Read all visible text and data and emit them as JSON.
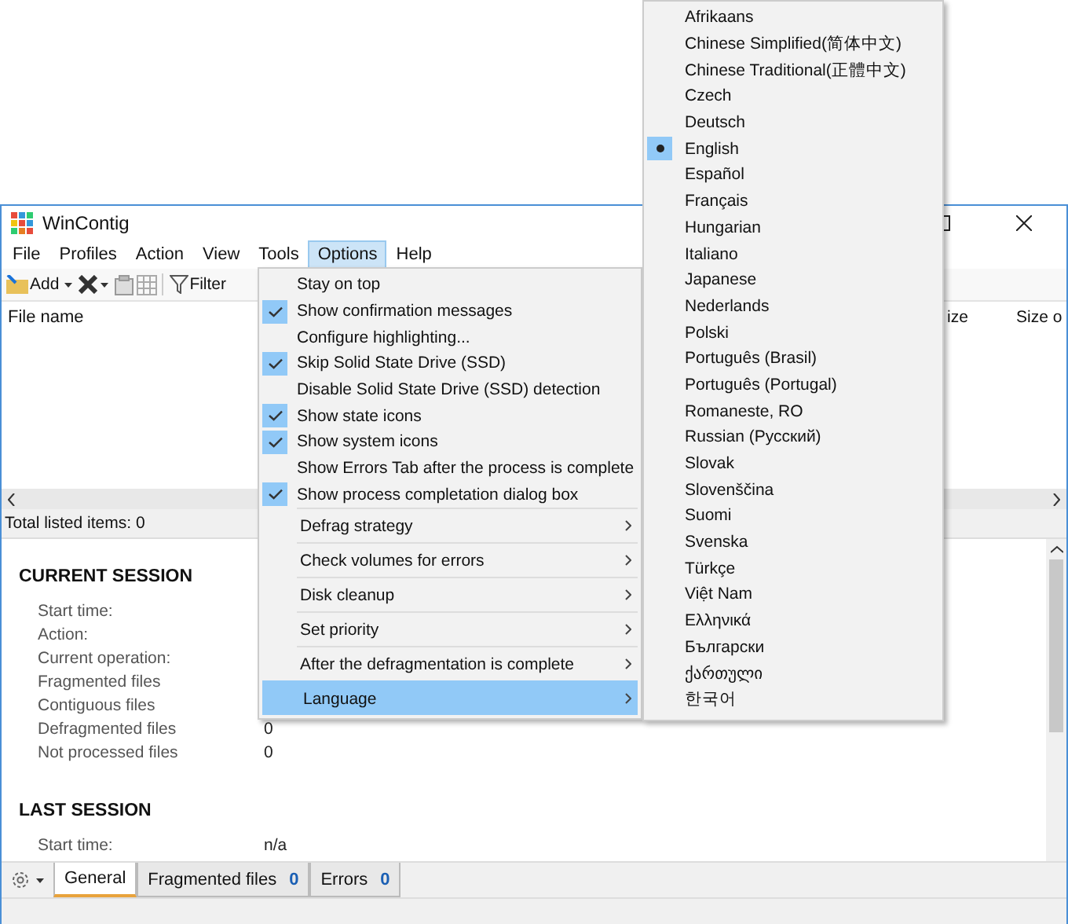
{
  "window": {
    "title": "WinContig"
  },
  "menu_bar": [
    {
      "label": "File",
      "selected": false
    },
    {
      "label": "Profiles",
      "selected": false
    },
    {
      "label": "Action",
      "selected": false
    },
    {
      "label": "View",
      "selected": false
    },
    {
      "label": "Tools",
      "selected": false
    },
    {
      "label": "Options",
      "selected": true
    },
    {
      "label": "Help",
      "selected": false
    }
  ],
  "toolbar": {
    "add_label": "Add",
    "filter_label": "Filter"
  },
  "file_list": {
    "columns": [
      "File name",
      "ize",
      "Size o"
    ]
  },
  "list_status": "Total listed items: 0",
  "sessions": [
    {
      "heading": "CURRENT SESSION",
      "fields": [
        {
          "label": "Start time:"
        },
        {
          "label": "Action:"
        },
        {
          "label": "Current operation:"
        },
        {
          "label": "Fragmented files"
        },
        {
          "label": "Contiguous files"
        },
        {
          "label": "Defragmented files",
          "value": "0"
        },
        {
          "label": "Not processed files",
          "value": "0"
        }
      ]
    },
    {
      "heading": "LAST SESSION",
      "fields": [
        {
          "label": "Start time:",
          "value": "n/a"
        }
      ]
    }
  ],
  "bottom_tabs": [
    {
      "label": "General",
      "selected": true
    },
    {
      "label": "Fragmented files",
      "count": "0",
      "selected": false
    },
    {
      "label": "Errors",
      "count": "0",
      "selected": false
    }
  ],
  "options_menu": {
    "items": [
      {
        "kind": "check",
        "label": "Stay on top",
        "checked": false,
        "selected": false
      },
      {
        "kind": "check",
        "label": "Show confirmation messages",
        "checked": true,
        "selected": false
      },
      {
        "kind": "check",
        "label": "Configure highlighting...",
        "checked": false,
        "selected": false
      },
      {
        "kind": "check",
        "label": "Skip Solid State Drive (SSD)",
        "checked": true,
        "selected": false
      },
      {
        "kind": "check",
        "label": "Disable Solid State Drive (SSD) detection",
        "checked": false,
        "selected": false
      },
      {
        "kind": "check",
        "label": "Show state icons",
        "checked": true,
        "selected": false
      },
      {
        "kind": "check",
        "label": "Show system icons",
        "checked": true,
        "selected": false
      },
      {
        "kind": "check",
        "label": "Show Errors Tab after the process is complete",
        "checked": false,
        "selected": false
      },
      {
        "kind": "check",
        "label": "Show process completation dialog box",
        "checked": true,
        "selected": false
      },
      {
        "kind": "submenu",
        "label": "Defrag strategy",
        "selected": false
      },
      {
        "kind": "submenu",
        "label": "Check volumes for errors",
        "selected": false
      },
      {
        "kind": "submenu",
        "label": "Disk cleanup",
        "selected": false
      },
      {
        "kind": "submenu",
        "label": "Set priority",
        "selected": false
      },
      {
        "kind": "submenu",
        "label": "After the defragmentation is complete",
        "selected": false
      },
      {
        "kind": "submenu",
        "label": "Language",
        "selected": true
      }
    ]
  },
  "language_menu": {
    "items": [
      {
        "label": "Afrikaans",
        "selected": false
      },
      {
        "label": "Chinese Simplified(简体中文)",
        "selected": false
      },
      {
        "label": "Chinese Traditional(正體中文)",
        "selected": false
      },
      {
        "label": "Czech",
        "selected": false
      },
      {
        "label": "Deutsch",
        "selected": false
      },
      {
        "label": "English",
        "selected": true
      },
      {
        "label": "Español",
        "selected": false
      },
      {
        "label": "Français",
        "selected": false
      },
      {
        "label": "Hungarian",
        "selected": false
      },
      {
        "label": "Italiano",
        "selected": false
      },
      {
        "label": "Japanese",
        "selected": false
      },
      {
        "label": "Nederlands",
        "selected": false
      },
      {
        "label": "Polski",
        "selected": false
      },
      {
        "label": "Português (Brasil)",
        "selected": false
      },
      {
        "label": "Português (Portugal)",
        "selected": false
      },
      {
        "label": "Romaneste, RO",
        "selected": false
      },
      {
        "label": "Russian (Русский)",
        "selected": false
      },
      {
        "label": "Slovak",
        "selected": false
      },
      {
        "label": "Slovenščina",
        "selected": false
      },
      {
        "label": "Suomi",
        "selected": false
      },
      {
        "label": "Svenska",
        "selected": false
      },
      {
        "label": "Türkçe",
        "selected": false
      },
      {
        "label": "Việt Nam",
        "selected": false
      },
      {
        "label": "Ελληνικά",
        "selected": false
      },
      {
        "label": "Български",
        "selected": false
      },
      {
        "label": "ქართული",
        "selected": false
      },
      {
        "label": "한국어",
        "selected": false
      }
    ]
  }
}
